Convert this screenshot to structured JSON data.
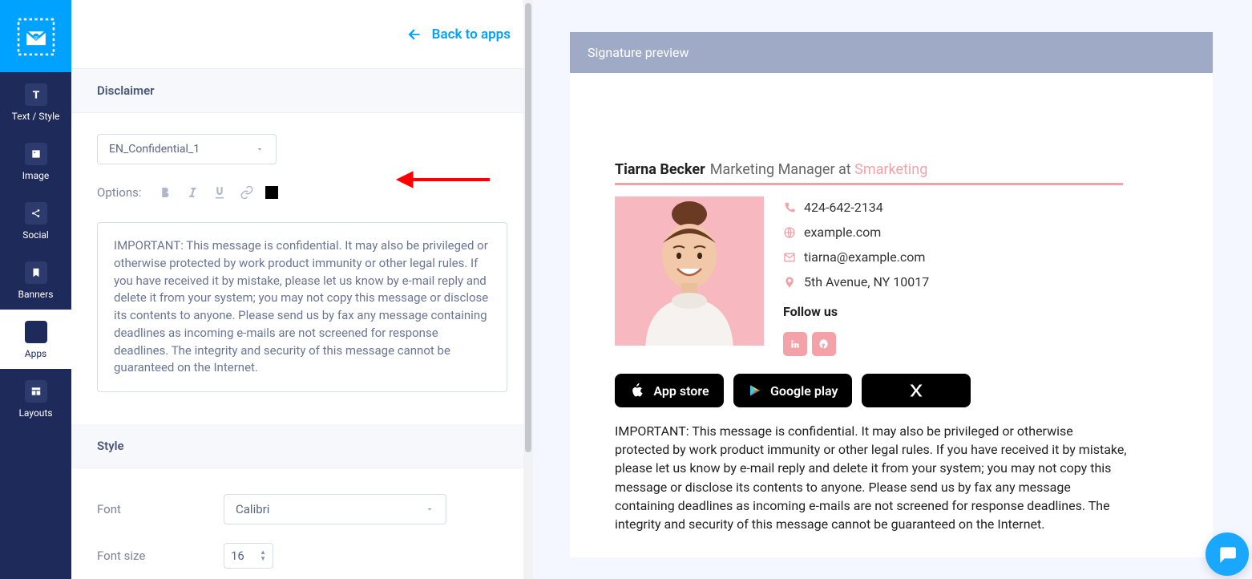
{
  "nav": {
    "items": [
      {
        "key": "logo"
      },
      {
        "key": "text-style",
        "label": "Text / Style"
      },
      {
        "key": "image",
        "label": "Image"
      },
      {
        "key": "social",
        "label": "Social"
      },
      {
        "key": "banners",
        "label": "Banners"
      },
      {
        "key": "apps",
        "label": "Apps"
      },
      {
        "key": "layouts",
        "label": "Layouts"
      }
    ]
  },
  "editor": {
    "back_label": "Back to apps",
    "disclaimer_header": "Disclaimer",
    "template_selected": "EN_Confidential_1",
    "options_label": "Options:",
    "disclaimer_text": "IMPORTANT: This message is confidential. It may also be privileged or otherwise protected by work product immunity or other legal rules. If you have received it by mistake, please let us know by e-mail reply and delete it from your system; you may not copy this message or disclose its contents to anyone. Please send us by fax any message containing deadlines as incoming e-mails are not screened for response deadlines. The integrity and security of this message cannot be guaranteed on the Internet.",
    "style_header": "Style",
    "font_label": "Font",
    "font_value": "Calibri",
    "font_size_label": "Font size",
    "font_size_value": "16",
    "color_value": "#000000"
  },
  "preview": {
    "header": "Signature preview",
    "name": "Tiarna Becker",
    "title_prefix": "Marketing Manager at ",
    "brand": "Smarketing",
    "phone": "424-642-2134",
    "website": "example.com",
    "email": "tiarna@example.com",
    "address": "5th Avenue, NY 10017",
    "follow_label": "Follow us",
    "stores": {
      "appstore": "App store",
      "googleplay": "Google play"
    },
    "disclaimer": "IMPORTANT: This message is confidential. It may also be privileged or otherwise protected by work product immunity or other legal rules. If you have received it by mistake, please let us know by e-mail reply and delete it from your system; you may not copy this message or disclose its contents to anyone. Please send us by fax any message containing deadlines as incoming e-mails are not screened for response deadlines. The integrity and security of this message cannot be guaranteed on the Internet."
  }
}
